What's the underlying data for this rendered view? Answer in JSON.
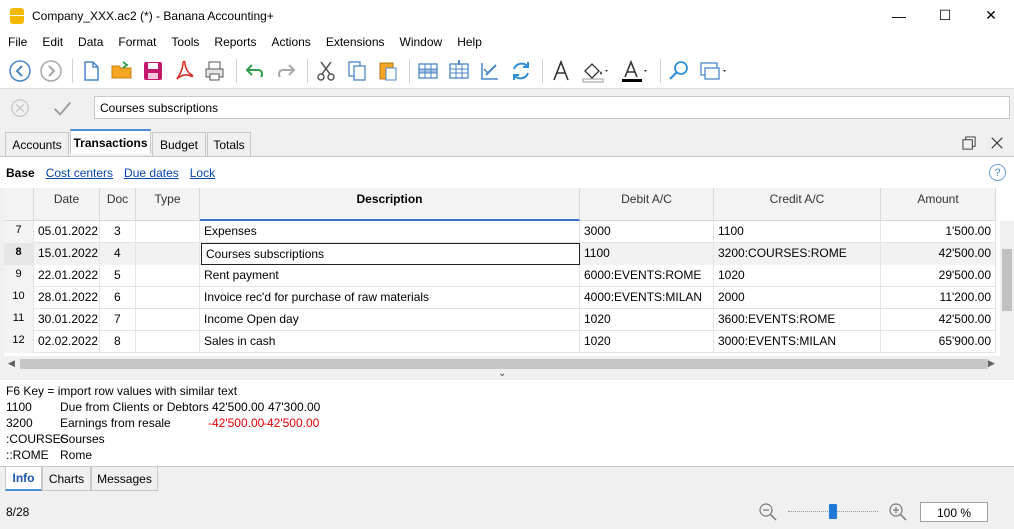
{
  "window": {
    "title": "Company_XXX.ac2 (*) - Banana Accounting+",
    "minimize": "—",
    "maximize": "☐",
    "close": "✕"
  },
  "menu": [
    "File",
    "Edit",
    "Data",
    "Format",
    "Tools",
    "Reports",
    "Actions",
    "Extensions",
    "Window",
    "Help"
  ],
  "toolbar": {
    "icons": [
      "back-icon",
      "forward-icon",
      "new-file-icon",
      "open-folder-icon",
      "save-icon",
      "pdf-icon",
      "print-preview-icon",
      "undo-icon",
      "redo-icon",
      "cut-icon",
      "copy-icon",
      "paste-icon",
      "add-row-icon",
      "insert-row-icon",
      "edit-row-icon",
      "recalculate-icon",
      "text-format-icon",
      "fill-color-icon",
      "font-color-icon",
      "search-icon",
      "window-switch-icon"
    ]
  },
  "edit": {
    "value": "Courses subscriptions"
  },
  "tabs": [
    "Accounts",
    "Transactions",
    "Budget",
    "Totals"
  ],
  "active_tab": "Transactions",
  "views": [
    "Base",
    "Cost centers",
    "Due dates",
    "Lock"
  ],
  "help_label": "?",
  "table": {
    "columns": [
      "",
      "Date",
      "Doc",
      "Type",
      "Description",
      "Debit A/C",
      "Credit A/C",
      "Amount"
    ],
    "rows": [
      {
        "n": "7",
        "date": "05.01.2022",
        "doc": "3",
        "type": "",
        "desc": "Expenses",
        "debit": "3000",
        "credit": "1100",
        "amount": "1'500.00"
      },
      {
        "n": "8",
        "date": "15.01.2022",
        "doc": "4",
        "type": "",
        "desc": "Courses subscriptions",
        "debit": "1100",
        "credit": "3200:COURSES:ROME",
        "amount": "42'500.00"
      },
      {
        "n": "9",
        "date": "22.01.2022",
        "doc": "5",
        "type": "",
        "desc": "Rent payment",
        "debit": "6000:EVENTS:ROME",
        "credit": "1020",
        "amount": "29'500.00"
      },
      {
        "n": "10",
        "date": "28.01.2022",
        "doc": "6",
        "type": "",
        "desc": "Invoice rec'd for purchase of raw materials",
        "debit": "4000:EVENTS:MILAN",
        "credit": "2000",
        "amount": "11'200.00"
      },
      {
        "n": "11",
        "date": "30.01.2022",
        "doc": "7",
        "type": "",
        "desc": "Income Open day",
        "debit": "1020",
        "credit": "3600:EVENTS:ROME",
        "amount": "42'500.00"
      },
      {
        "n": "12",
        "date": "02.02.2022",
        "doc": "8",
        "type": "",
        "desc": "Sales in cash",
        "debit": "1020",
        "credit": "3000:EVENTS:MILAN",
        "amount": "65'900.00"
      }
    ]
  },
  "info": {
    "hint": "F6 Key = import row values with similar text",
    "lines": [
      {
        "code": "1100",
        "name": "Due from Clients or Debtors",
        "v1": "42'500.00",
        "v2": "47'300.00",
        "negative": false
      },
      {
        "code": "3200",
        "name": "Earnings from resale",
        "v1": "-42'500.00",
        "v2": "-42'500.00",
        "negative": true
      },
      {
        "code": ":COURSES",
        "name": "Courses",
        "v1": "",
        "v2": "",
        "negative": false
      },
      {
        "code": "::ROME",
        "name": "Rome",
        "v1": "",
        "v2": "",
        "negative": false
      }
    ]
  },
  "bottom_tabs": [
    "Info",
    "Charts",
    "Messages"
  ],
  "status": {
    "position": "8/28",
    "zoom": "100 %"
  }
}
